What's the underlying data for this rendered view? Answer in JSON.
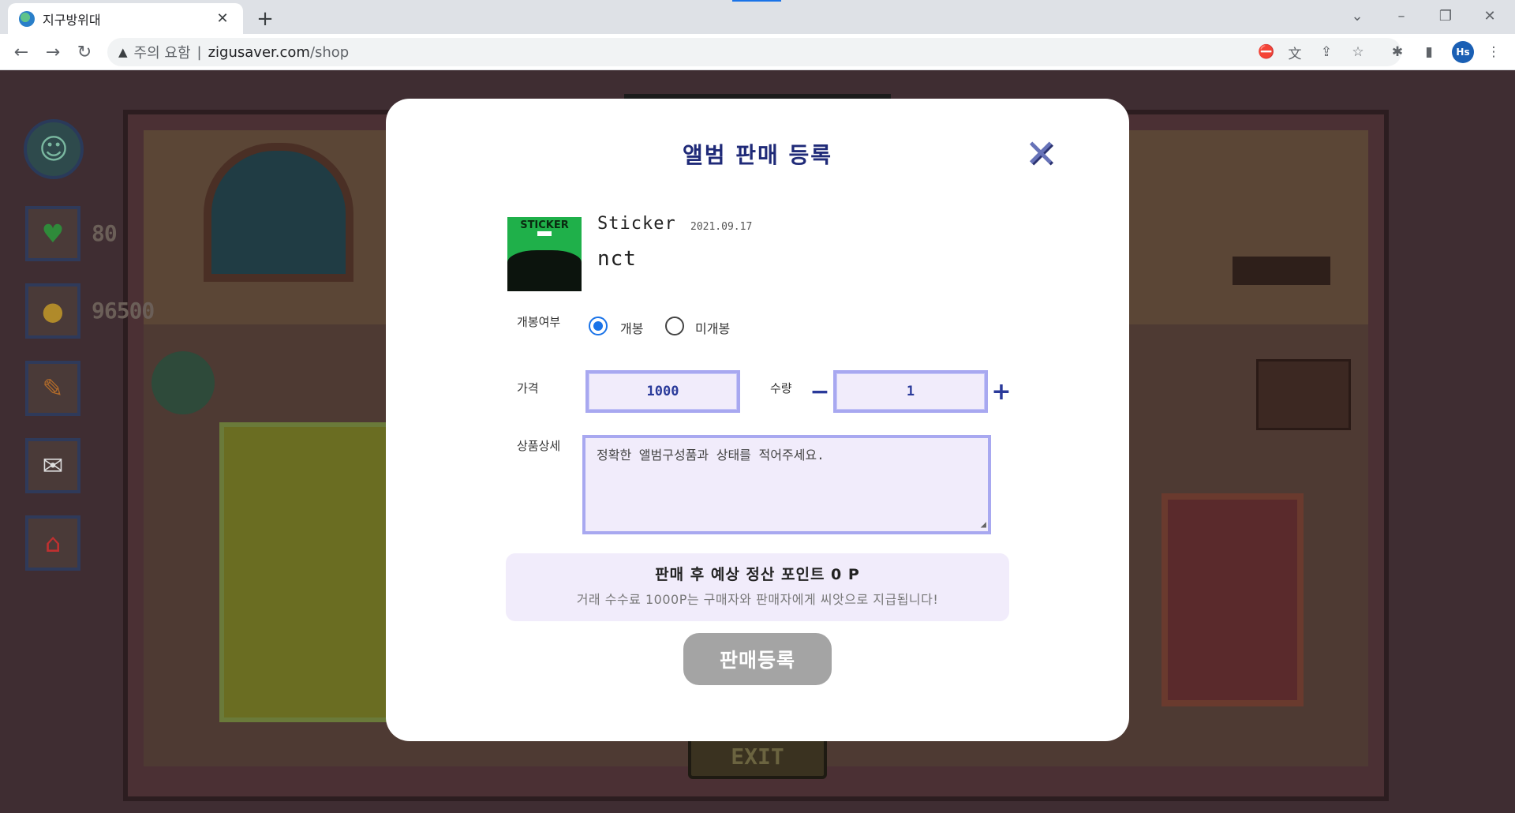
{
  "browser": {
    "tab_title": "지구방위대",
    "tab_close": "✕",
    "new_tab": "+",
    "address": {
      "warning": "주의 요함",
      "separator": "|",
      "host": "zigusaver.com",
      "path": "/shop"
    },
    "profile_initials": "Hs"
  },
  "game": {
    "stats": {
      "sprout": "80",
      "coins": "96500"
    },
    "exit_label": "EXIT"
  },
  "modal": {
    "title": "앨범 판매 등록",
    "album": {
      "cover_text": "STICKER",
      "name": "Sticker",
      "release_date": "2021.09.17",
      "artist": "nct"
    },
    "opened": {
      "label": "개봉여부",
      "options": [
        "개봉",
        "미개봉"
      ],
      "selected": "개봉"
    },
    "price": {
      "label": "가격",
      "value": "1000"
    },
    "quantity": {
      "label": "수량",
      "value": "1",
      "minus": "−",
      "plus": "+"
    },
    "detail": {
      "label": "상품상세",
      "placeholder": "정확한 앨범구성품과 상태를 적어주세요."
    },
    "summary": {
      "line1": "판매 후 예상 정산 포인트 0 P",
      "line2": "거래 수수료 1000P는 구매자와 판매자에게 씨앗으로 지급됩니다!"
    },
    "submit_label": "판매등록"
  },
  "colors": {
    "accent_purple": "#a8a8f0",
    "title_navy": "#1f2a78",
    "submit_gray": "#a4a4a4",
    "radio_blue": "#1a73e8"
  }
}
